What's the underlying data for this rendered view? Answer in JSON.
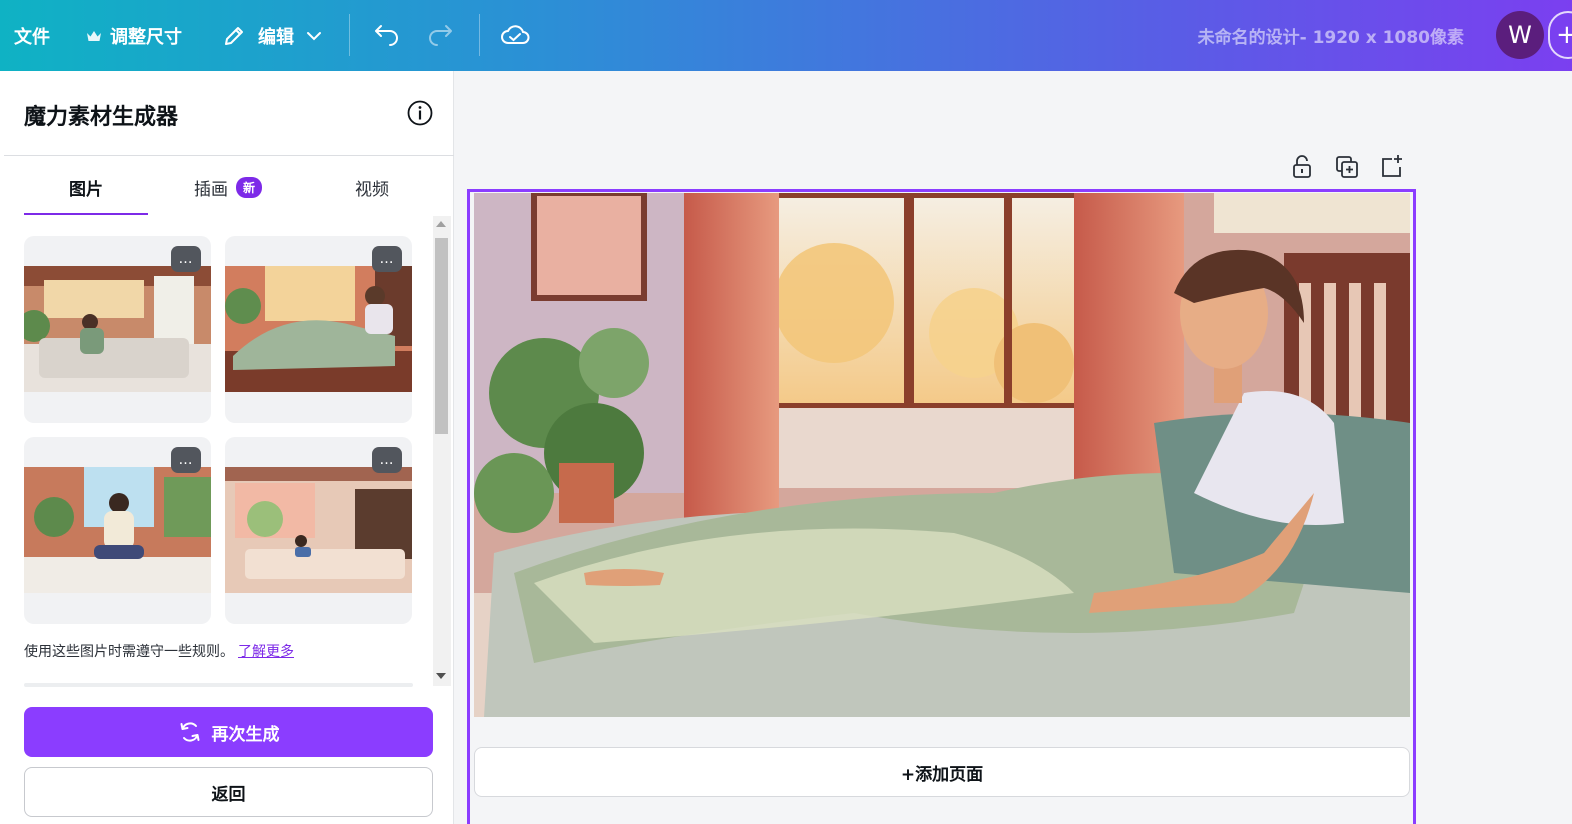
{
  "topbar": {
    "file_label": "文件",
    "resize_label": "调整尺寸",
    "edit_label": "编辑",
    "doc_title": "未命名的设计- 1920 x 1080像素",
    "avatar_letter": "W",
    "plus_label": "+"
  },
  "panel": {
    "title": "魔力素材生成器",
    "tabs": [
      {
        "label": "图片",
        "active": true
      },
      {
        "label": "插画",
        "badge": "新"
      },
      {
        "label": "视频"
      }
    ],
    "more_label": "…",
    "rules_text": "使用这些图片时需遵守一些规则。",
    "rules_link": "了解更多",
    "regenerate_label": "再次生成",
    "back_label": "返回"
  },
  "canvas": {
    "add_page_label": "+添加页面"
  },
  "colors": {
    "accent": "#8b3dff",
    "tab_underline": "#7d2ae8",
    "avatar_bg": "#5b1e7d"
  },
  "icons": [
    "crown-icon",
    "pencil-icon",
    "chevron-down-icon",
    "undo-icon",
    "redo-icon",
    "cloud-check-icon",
    "info-icon",
    "refresh-icon",
    "lock-icon",
    "duplicate-icon",
    "add-page-icon",
    "more-icon"
  ]
}
